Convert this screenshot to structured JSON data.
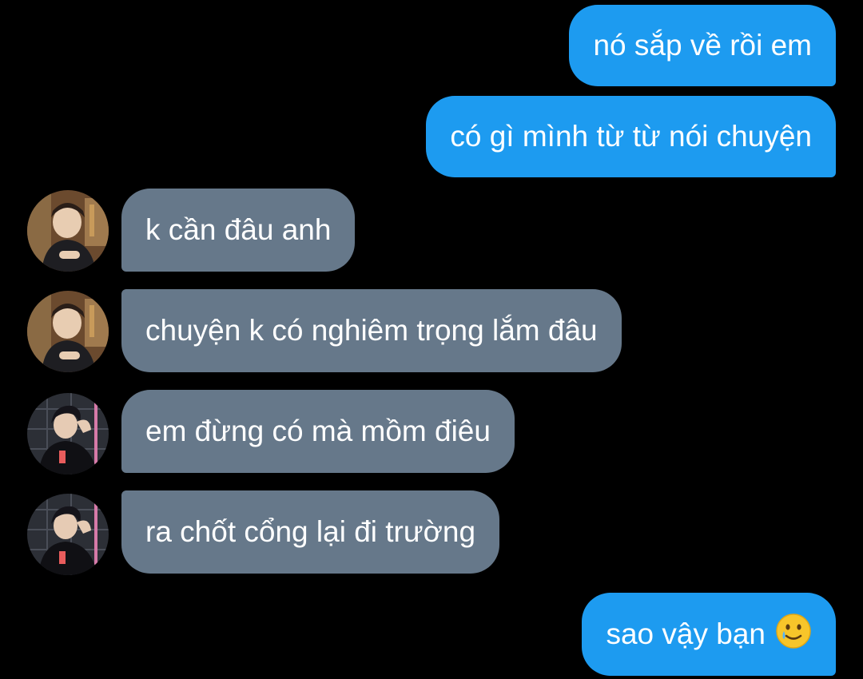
{
  "conversation": {
    "messages": [
      {
        "direction": "outgoing",
        "text": "nó sắp về rồi em"
      },
      {
        "direction": "outgoing",
        "text": "có gì mình từ từ nói chuyện"
      },
      {
        "direction": "incoming",
        "sender_avatar": "avatar-a",
        "text": "k cần đâu anh"
      },
      {
        "direction": "incoming",
        "sender_avatar": "avatar-a",
        "text": "chuyện k có nghiêm trọng lắm đâu"
      },
      {
        "direction": "incoming",
        "sender_avatar": "avatar-b",
        "text": "em đừng có mà mồm điêu"
      },
      {
        "direction": "incoming",
        "sender_avatar": "avatar-b",
        "text": "ra chốt cổng lại đi trường"
      },
      {
        "direction": "outgoing",
        "text": "sao vậy bạn",
        "emoji": "smiling-face-with-tear"
      }
    ]
  },
  "colors": {
    "background": "#000000",
    "outgoing_bubble": "#1d9bf0",
    "incoming_bubble": "#66788a",
    "text": "#ffffff"
  }
}
